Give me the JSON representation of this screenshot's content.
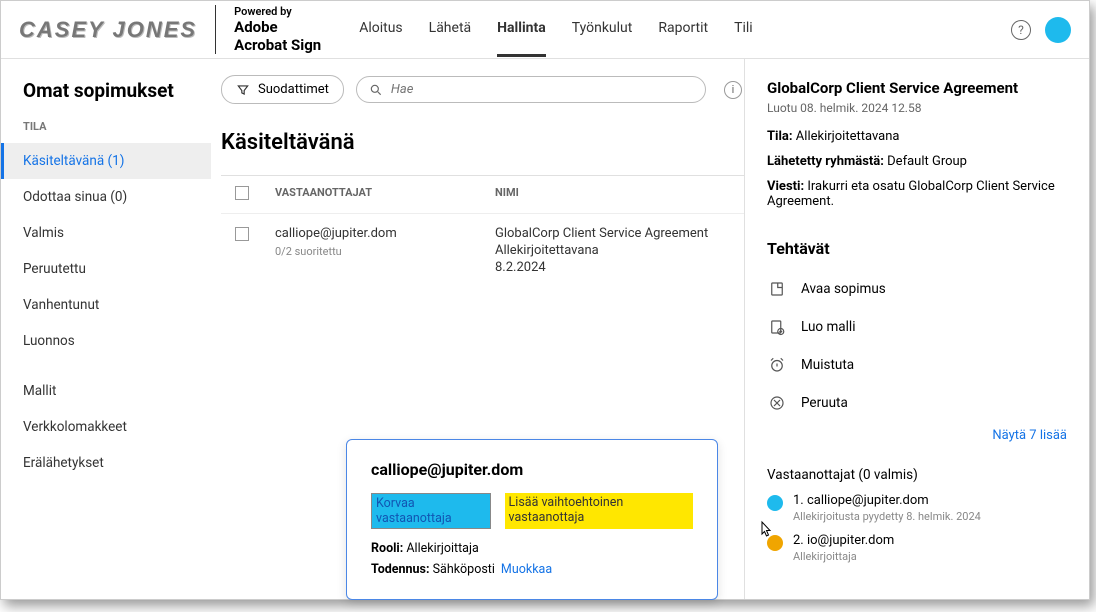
{
  "brand": {
    "logo": "CASEY JONES",
    "powered_by": "Powered by",
    "acrobat1": "Adobe",
    "acrobat2": "Acrobat Sign"
  },
  "nav": {
    "items": [
      "Aloitus",
      "Lähetä",
      "Hallinta",
      "Työnkulut",
      "Raportit",
      "Tili"
    ],
    "active": 2
  },
  "sidebar": {
    "title": "Omat sopimukset",
    "tila": "TILA",
    "items": [
      "Käsiteltävänä (1)",
      "Odottaa sinua (0)",
      "Valmis",
      "Peruutettu",
      "Vanhentunut",
      "Luonnos"
    ],
    "extra": [
      "Mallit",
      "Verkkolomakkeet",
      "Erälähetykset"
    ]
  },
  "toolbar": {
    "filter": "Suodattimet",
    "search_placeholder": "Hae"
  },
  "section": {
    "title": "Käsiteltävänä",
    "cols": {
      "rec": "VASTAANOTTAJAT",
      "name": "NIMI"
    },
    "row": {
      "email": "calliope@jupiter.dom",
      "sub": "0/2 suoritettu",
      "name": "GlobalCorp Client Service Agreement",
      "status": "Allekirjoitettavana",
      "date": "8.2.2024"
    }
  },
  "popup": {
    "title": "calliope@jupiter.dom",
    "link1": "Korvaa vastaanottaja",
    "link2": "Lisää vaihtoehtoinen vastaanottaja",
    "role_label": "Rooli:",
    "role_val": "Allekirjoittaja",
    "auth_label": "Todennus:",
    "auth_val": "Sähköposti",
    "edit": "Muokkaa"
  },
  "detail": {
    "title": "GlobalCorp Client Service Agreement",
    "date": "Luotu 08. helmik. 2024 12.58",
    "tila_label": "Tila:",
    "tila_val": "Allekirjoitettavana",
    "group_label": "Lähetetty ryhmästä:",
    "group_val": "Default Group",
    "msg_label": "Viesti:",
    "msg_val": "Irakurri eta osatu GlobalCorp Client Service Agreement.",
    "actions_title": "Tehtävät",
    "actions": [
      "Avaa sopimus",
      "Luo malli",
      "Muistuta",
      "Peruuta"
    ],
    "show_more": "Näytä 7 lisää",
    "recip_title": "Vastaanottajat (0 valmis)",
    "recipients": [
      {
        "name": "1. calliope@jupiter.dom",
        "sub": "Allekirjoitusta pyydetty 8. helmik. 2024",
        "color": "blue"
      },
      {
        "name": "2. io@jupiter.dom",
        "sub": "Allekirjoittaja",
        "color": "yellow"
      }
    ]
  }
}
